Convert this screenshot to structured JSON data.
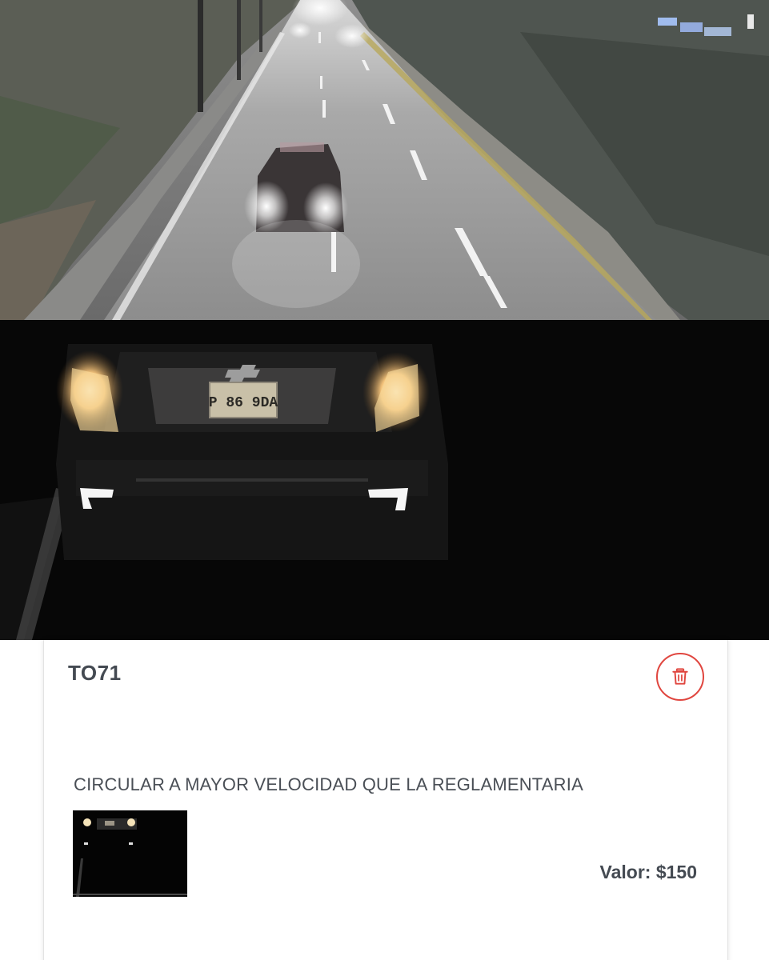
{
  "camera_photo": {
    "plate_text": "P 86 9DA"
  },
  "fine": {
    "code": "TO71",
    "description": "CIRCULAR A MAYOR VELOCIDAD QUE LA REGLAMENTARIA",
    "amount": "Valor: $150"
  },
  "icons": {
    "delete": "trash-icon"
  },
  "colors": {
    "accent_red": "#e0463f",
    "text_dark": "#444a52",
    "text_body": "#4a4f56"
  }
}
